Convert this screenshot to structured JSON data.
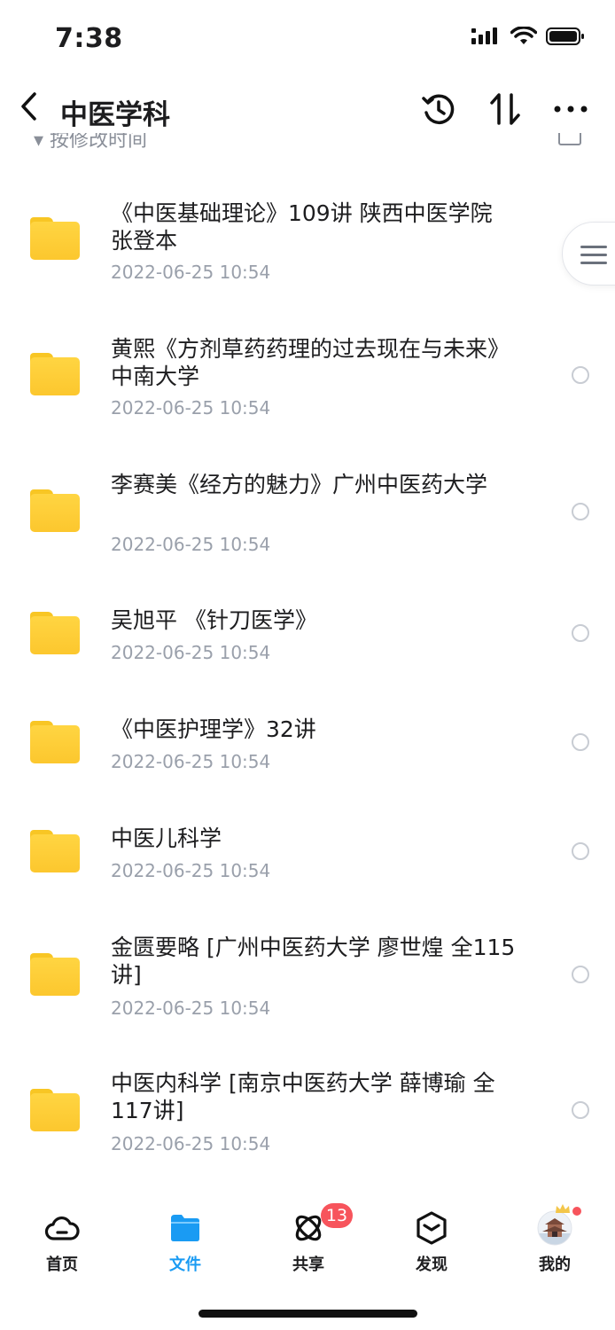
{
  "status_bar": {
    "time": "7:38"
  },
  "nav": {
    "title": "中医学科"
  },
  "sort": {
    "label": "按修改时间"
  },
  "files": [
    {
      "name": "《中医基础理论》109讲 陕西中医学院 张登本",
      "date": "2022-06-25 10:54"
    },
    {
      "name": "黄熙《方剂草药药理的过去现在与未来》中南大学",
      "date": "2022-06-25 10:54"
    },
    {
      "name": "李赛美《经方的魅力》广州中医药大学",
      "date": "2022-06-25 10:54"
    },
    {
      "name": "吴旭平 《针刀医学》",
      "date": "2022-06-25 10:54"
    },
    {
      "name": "《中医护理学》32讲",
      "date": "2022-06-25 10:54"
    },
    {
      "name": "中医儿科学",
      "date": "2022-06-25 10:54"
    },
    {
      "name": "金匮要略 [广州中医药大学 廖世煌 全115讲]",
      "date": "2022-06-25 10:54"
    },
    {
      "name": "中医内科学 [南京中医药大学 薛博瑜 全117讲]",
      "date": "2022-06-25 10:54"
    }
  ],
  "tabbar": {
    "items": [
      {
        "label": "首页",
        "icon": "cloud-icon"
      },
      {
        "label": "文件",
        "icon": "folder-icon",
        "active": true
      },
      {
        "label": "共享",
        "icon": "share-orbit-icon"
      },
      {
        "label": "发现",
        "icon": "cube-icon"
      },
      {
        "label": "我的",
        "icon": "avatar"
      }
    ],
    "share_badge": "13"
  },
  "colors": {
    "accent": "#1a9bf3",
    "badge": "#f7545c",
    "folder": "#fcc72e"
  }
}
